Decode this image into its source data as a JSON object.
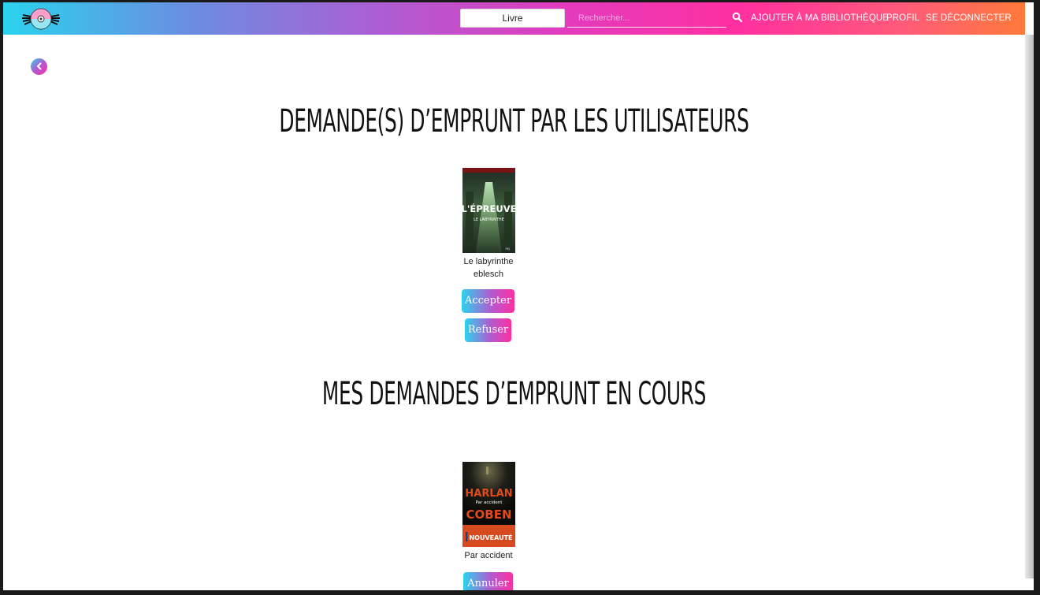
{
  "navbar": {
    "logo_icon": "disc-logo-icon",
    "search_type": "Livre",
    "search_placeholder": "Rechercher...",
    "search_icon": "search-icon",
    "links": {
      "add": "AJOUTER À MA BIBLIOTHÈQUE",
      "profile": "PROFIL",
      "logout": "SE DÉCONNECTER"
    }
  },
  "back_icon": "chevron-left-icon",
  "sections": {
    "incoming": {
      "heading": "DEMANDE(S) D’EMPRUNT PAR LES UTILISATEURS",
      "items": [
        {
          "cover_text_1": "L'ÉPREUVE",
          "cover_text_2": "LE LABYRINTHE",
          "cover_text_3": "PKJ",
          "title": "Le labyrinthe",
          "owner": "eblesch",
          "accept_label": "Accepter",
          "refuse_label": "Refuser"
        }
      ]
    },
    "outgoing": {
      "heading": "MES DEMANDES D’EMPRUNT EN COURS",
      "items": [
        {
          "cover_text_1": "HARLAN",
          "cover_text_2": "Par accident",
          "cover_text_3": "COBEN",
          "cover_badge": "NOUVEAUTÉ",
          "title": "Par accident",
          "cancel_label": "Annuler"
        }
      ]
    }
  },
  "colors": {
    "gradient_start": "#2bd3ee",
    "gradient_mid": "#e23bbd",
    "gradient_end": "#ff7a3a",
    "heading_text": "#111111"
  }
}
